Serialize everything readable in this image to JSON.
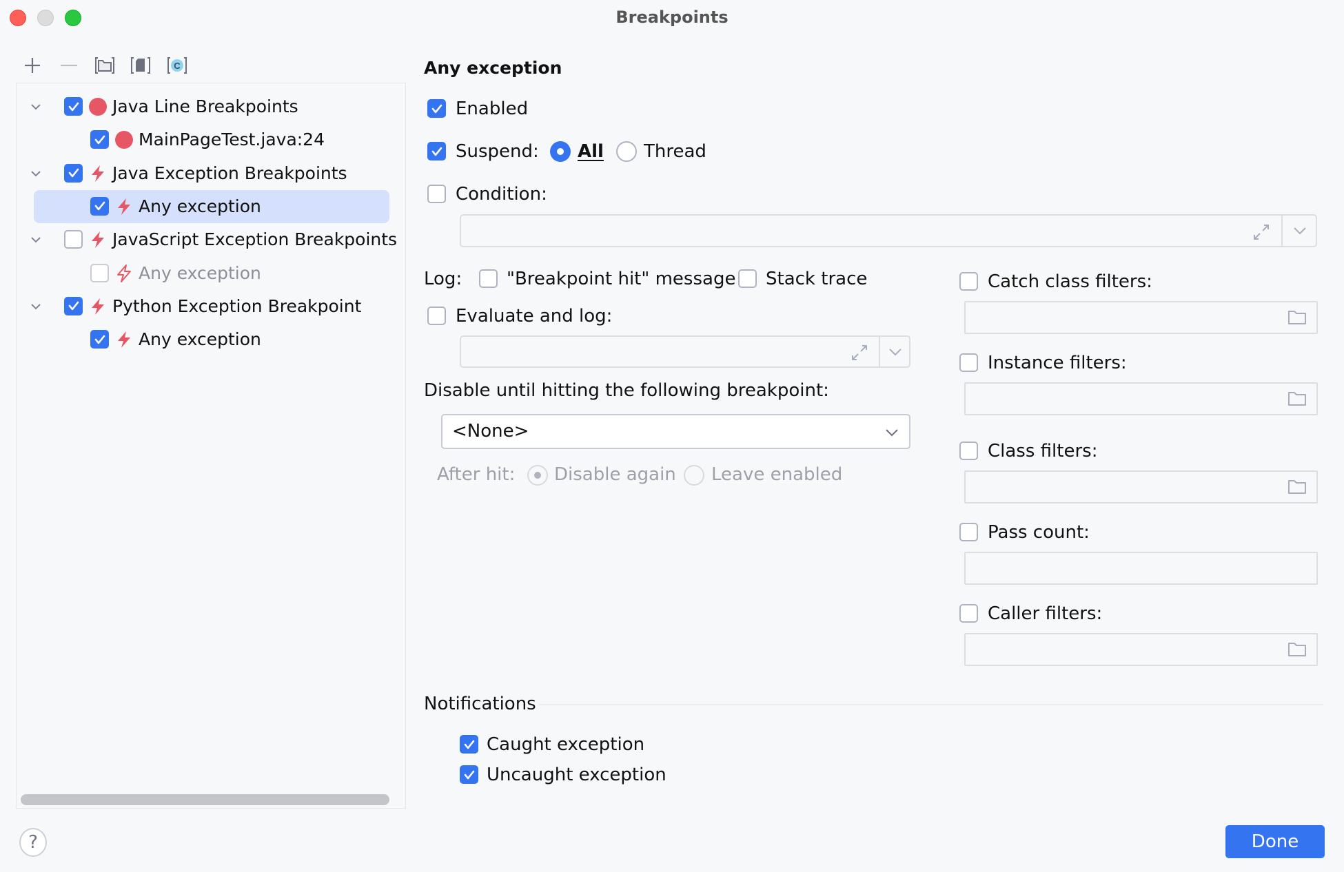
{
  "window": {
    "title": "Breakpoints",
    "controls": [
      "close",
      "minimize",
      "zoom"
    ]
  },
  "colors": {
    "accent": "#3574f0",
    "breakpoint_red": "#e55765",
    "selection": "#d5e1fc",
    "background": "#f7f8fa"
  },
  "toolbar": {
    "items": [
      {
        "name": "add-icon",
        "tooltip": "Add"
      },
      {
        "name": "remove-icon",
        "tooltip": "Remove"
      },
      {
        "name": "group-by-package-icon",
        "tooltip": "Group by package"
      },
      {
        "name": "group-by-file-icon",
        "tooltip": "Group by file"
      },
      {
        "name": "group-by-class-icon",
        "tooltip": "Group by class"
      }
    ]
  },
  "tree": {
    "items": [
      {
        "label": "Java Line Breakpoints",
        "level": 0,
        "checked": true,
        "icon": "line-breakpoint-icon",
        "expanded": true,
        "selected": false,
        "dim": false
      },
      {
        "label": "MainPageTest.java:24",
        "level": 1,
        "checked": true,
        "icon": "line-breakpoint-icon",
        "selected": false,
        "dim": false
      },
      {
        "label": "Java Exception Breakpoints",
        "level": 0,
        "checked": true,
        "icon": "exception-breakpoint-icon",
        "expanded": true,
        "selected": false,
        "dim": false
      },
      {
        "label": "Any exception",
        "level": 1,
        "checked": true,
        "icon": "exception-breakpoint-icon",
        "selected": true,
        "dim": false
      },
      {
        "label": "JavaScript Exception Breakpoints",
        "level": 0,
        "checked": false,
        "icon": "exception-breakpoint-icon",
        "expanded": true,
        "selected": false,
        "dim": false
      },
      {
        "label": "Any exception",
        "level": 1,
        "checked": false,
        "icon": "exception-breakpoint-disabled-icon",
        "selected": false,
        "dim": true
      },
      {
        "label": "Python Exception Breakpoint",
        "level": 0,
        "checked": true,
        "icon": "exception-breakpoint-icon",
        "expanded": true,
        "selected": false,
        "dim": false
      },
      {
        "label": "Any exception",
        "level": 1,
        "checked": true,
        "icon": "exception-breakpoint-icon",
        "selected": false,
        "dim": false
      }
    ]
  },
  "details": {
    "header": "Any exception",
    "enabled": {
      "label": "Enabled",
      "checked": true
    },
    "suspend": {
      "label": "Suspend:",
      "checked": true,
      "options": [
        "All",
        "Thread"
      ],
      "selected": "All"
    },
    "condition": {
      "label": "Condition:",
      "checked": false,
      "value": ""
    },
    "log": {
      "label": "Log:",
      "breakpoint_hit": {
        "label": "\"Breakpoint hit\" message",
        "checked": false
      },
      "stack_trace": {
        "label": "Stack trace",
        "checked": false
      }
    },
    "evaluate_and_log": {
      "label": "Evaluate and log:",
      "checked": false,
      "value": ""
    },
    "disable_until": {
      "label": "Disable until hitting the following breakpoint:",
      "selected": "<None>"
    },
    "after_hit": {
      "label": "After hit:",
      "options": [
        "Disable again",
        "Leave enabled"
      ],
      "selected": "Disable again",
      "disabled": true
    },
    "filters": [
      {
        "label": "Catch class filters:",
        "checked": false,
        "value": "",
        "browse": true
      },
      {
        "label": "Instance filters:",
        "checked": false,
        "value": "",
        "browse": true
      },
      {
        "label": "Class filters:",
        "checked": false,
        "value": "",
        "browse": true
      },
      {
        "label": "Pass count:",
        "checked": false,
        "value": "",
        "browse": false
      },
      {
        "label": "Caller filters:",
        "checked": false,
        "value": "",
        "browse": true
      }
    ],
    "notifications": {
      "label": "Notifications",
      "caught": {
        "label": "Caught exception",
        "checked": true
      },
      "uncaught": {
        "label": "Uncaught exception",
        "checked": true
      }
    }
  },
  "footer": {
    "help": "?",
    "done": "Done"
  }
}
